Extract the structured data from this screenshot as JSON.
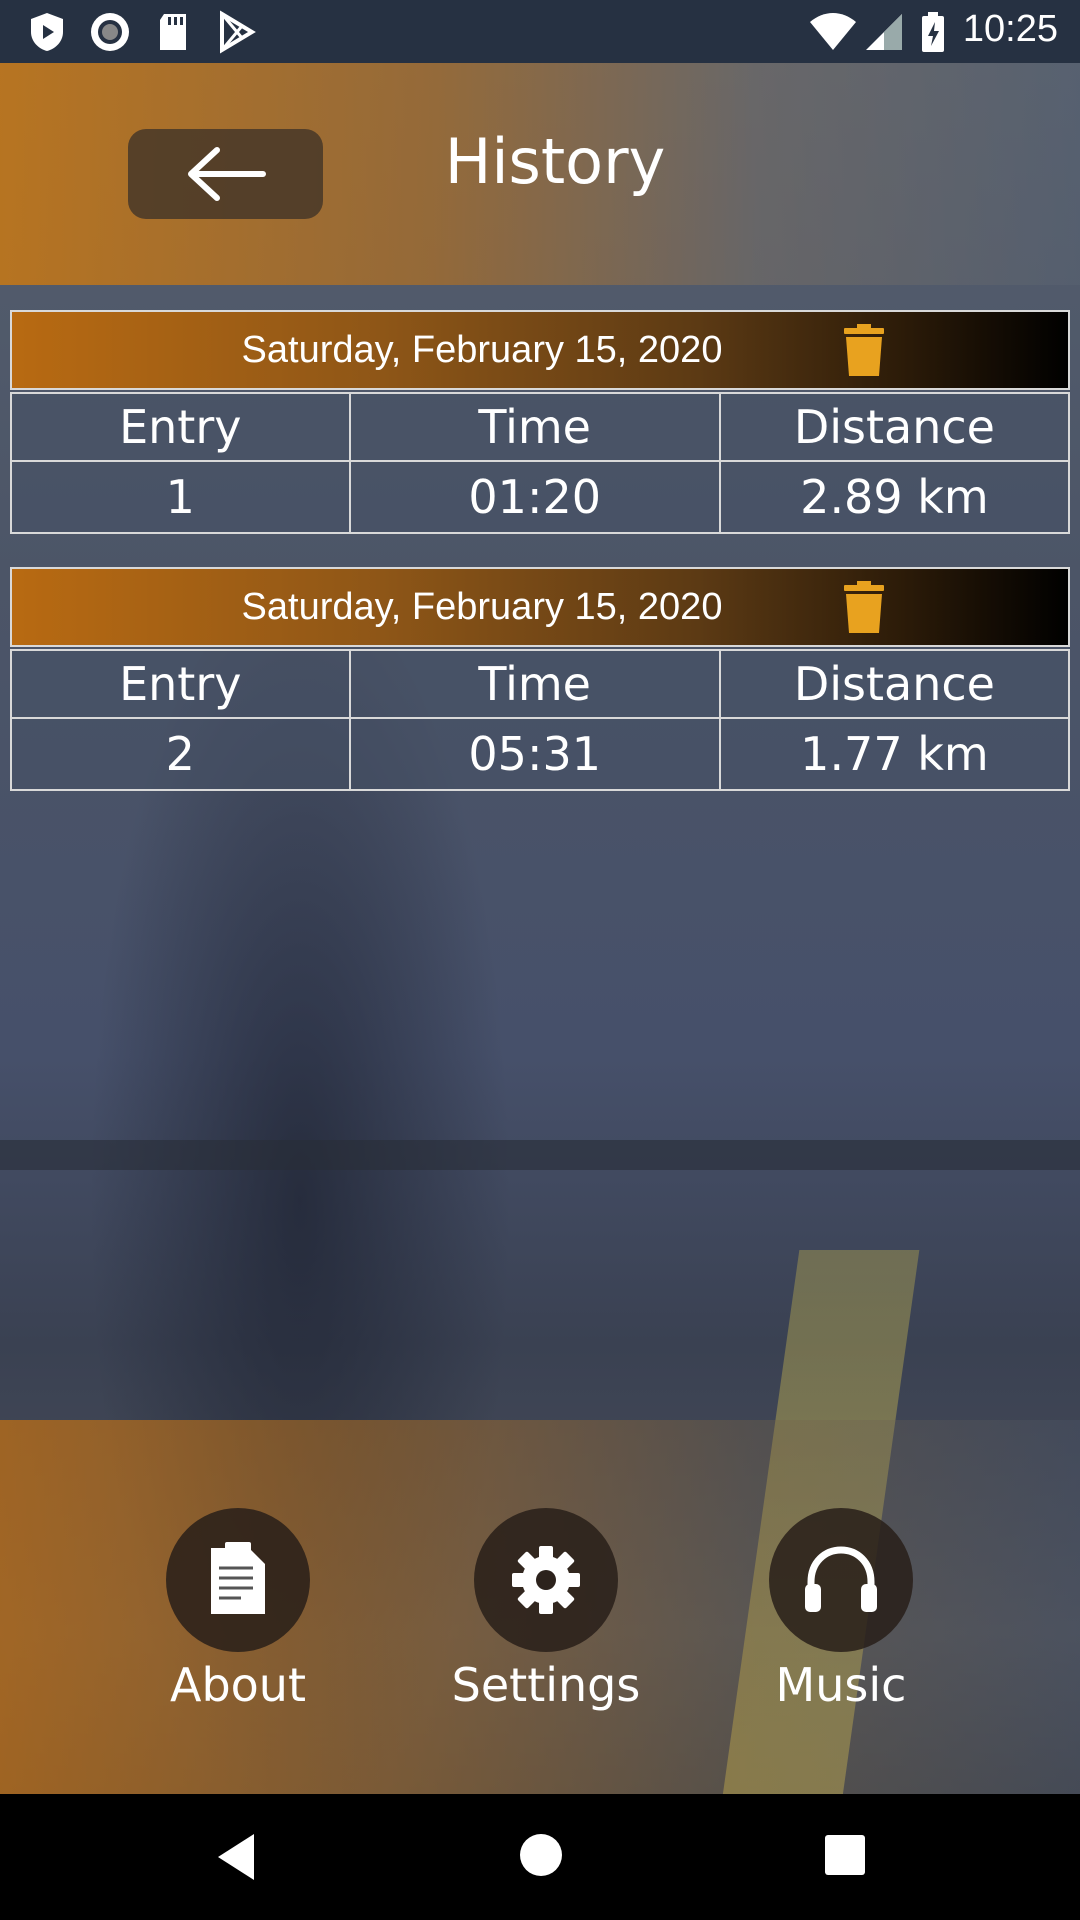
{
  "status_bar": {
    "time": "10:25",
    "icons": [
      "shield-play-icon",
      "record-icon",
      "sd-card-icon",
      "play-store-icon",
      "wifi-icon",
      "signal-icon",
      "battery-charging-icon"
    ]
  },
  "header": {
    "title": "History",
    "back_icon": "arrow-left-icon"
  },
  "records": [
    {
      "date": "Saturday, February 15, 2020",
      "columns": [
        "Entry",
        "Time",
        "Distance"
      ],
      "values": [
        "1",
        "01:20",
        "2.89 km"
      ],
      "delete_icon": "trash-icon"
    },
    {
      "date": "Saturday, February 15, 2020",
      "columns": [
        "Entry",
        "Time",
        "Distance"
      ],
      "values": [
        "2",
        "05:31",
        "1.77 km"
      ],
      "delete_icon": "trash-icon"
    }
  ],
  "bottom_nav": [
    {
      "label": "About",
      "icon": "document-icon"
    },
    {
      "label": "Settings",
      "icon": "gear-icon"
    },
    {
      "label": "Music",
      "icon": "headphones-icon"
    }
  ],
  "colors": {
    "accent": "#e8a21f",
    "header_orange": "#c87814",
    "status_bar": "#263142"
  }
}
